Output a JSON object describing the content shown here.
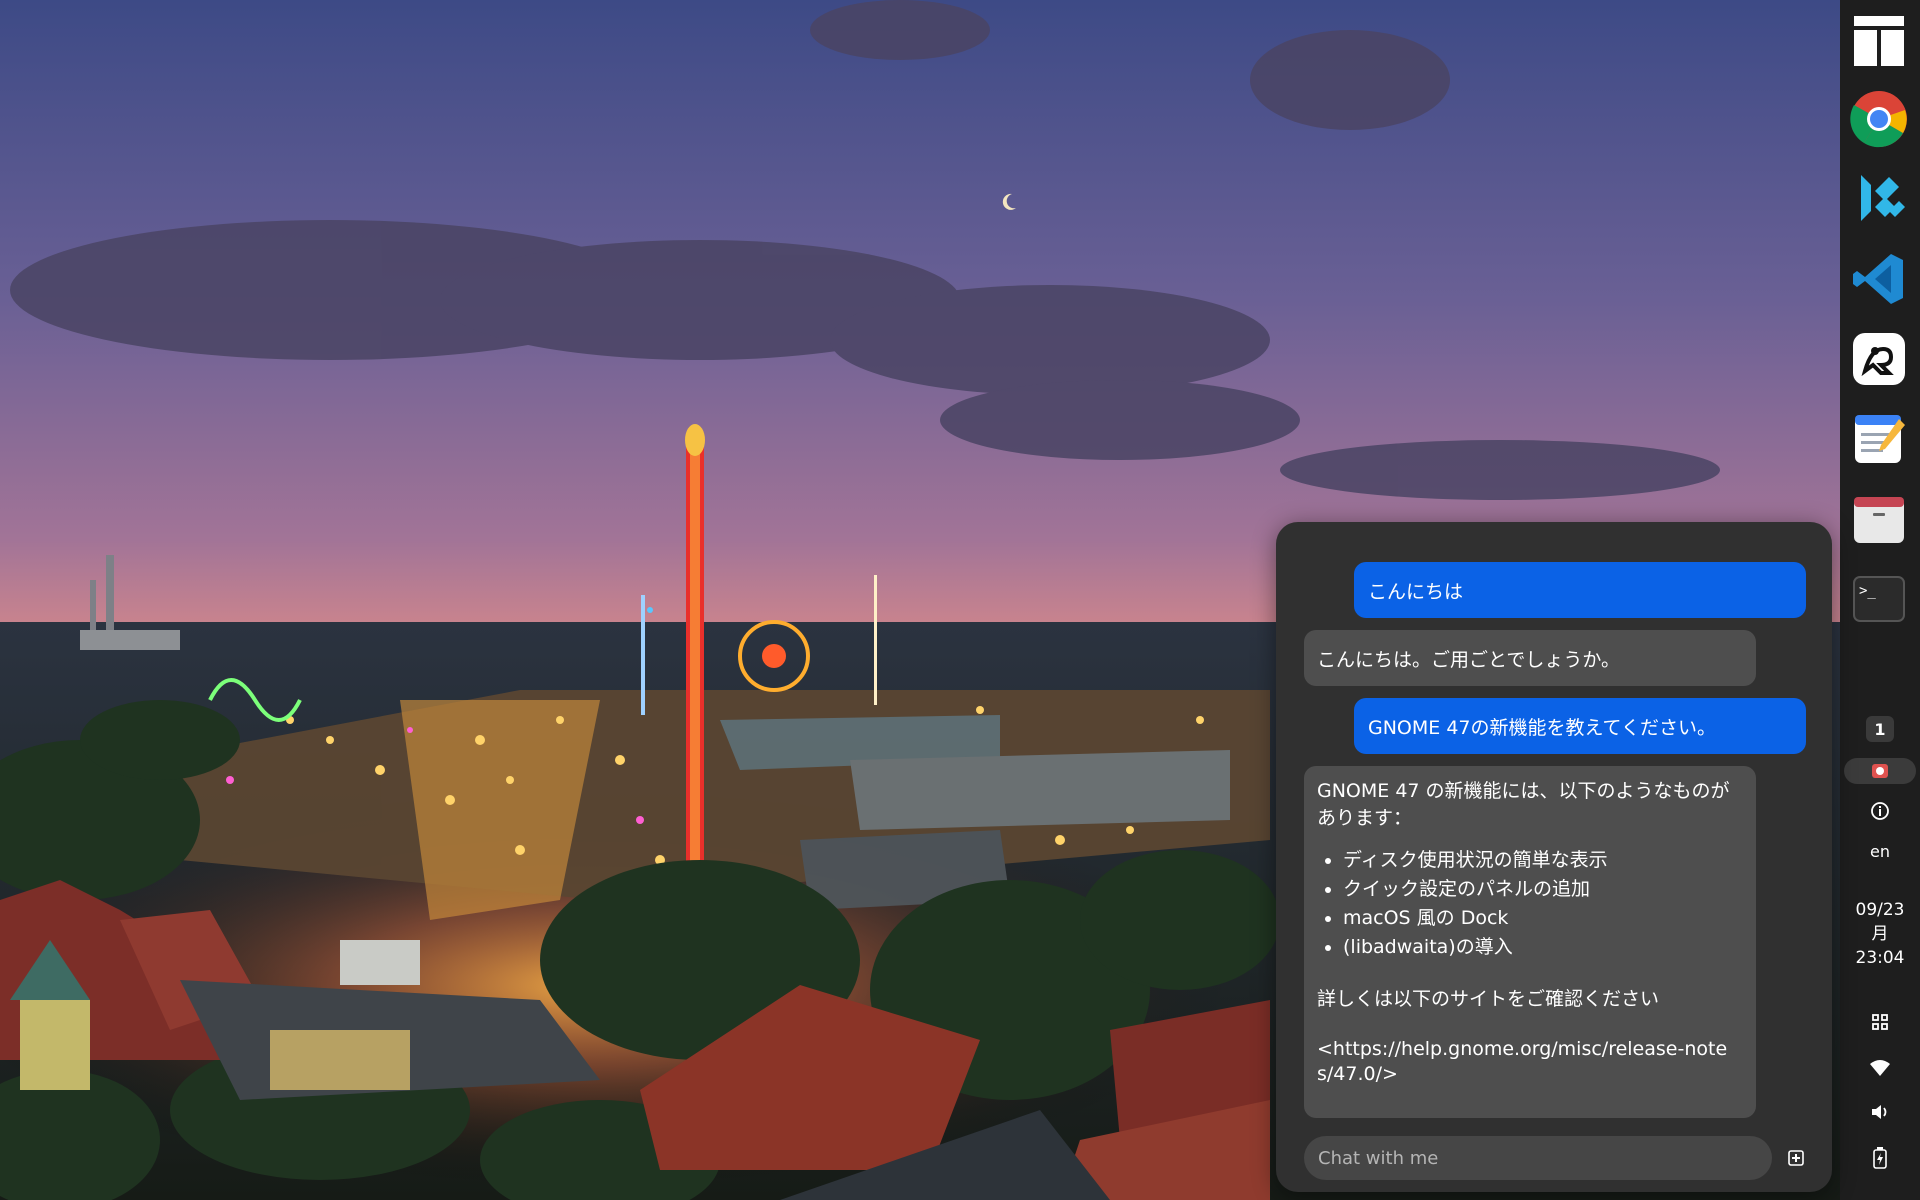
{
  "dock": {
    "apps": [
      {
        "name": "window-manager-icon"
      },
      {
        "name": "chrome-icon"
      },
      {
        "name": "kodi-icon"
      },
      {
        "name": "vscode-icon"
      },
      {
        "name": "inkscape-icon"
      },
      {
        "name": "text-editor-icon"
      },
      {
        "name": "files-icon"
      },
      {
        "name": "terminal-icon"
      }
    ],
    "workspace": "1",
    "language": "en",
    "date": "09/23",
    "weekday": "月",
    "time": "23:04"
  },
  "chat": {
    "messages": [
      {
        "role": "user",
        "text": "こんにちは"
      },
      {
        "role": "assistant",
        "text": "こんにちは。ご用ごとでしょうか。"
      },
      {
        "role": "user",
        "text": "GNOME 47の新機能を教えてください。"
      },
      {
        "role": "assistant",
        "intro": "GNOME 47 の新機能には、以下のようなものがあります：",
        "items": [
          "ディスク使用状況の簡単な表示",
          "クイック設定のパネルの追加",
          "macOS 風の Dock",
          "(libadwaita)の導入"
        ],
        "outro": "詳しくは以下のサイトをご確認ください",
        "link": "<https://help.gnome.org/misc/release-notes/47.0/>"
      }
    ],
    "input_placeholder": "Chat with me"
  },
  "colors": {
    "user_bubble": "#0b62e6",
    "assistant_bubble": "#4e4e4e",
    "popup_bg": "#303030",
    "dock_bg": "#1e1e1e"
  }
}
